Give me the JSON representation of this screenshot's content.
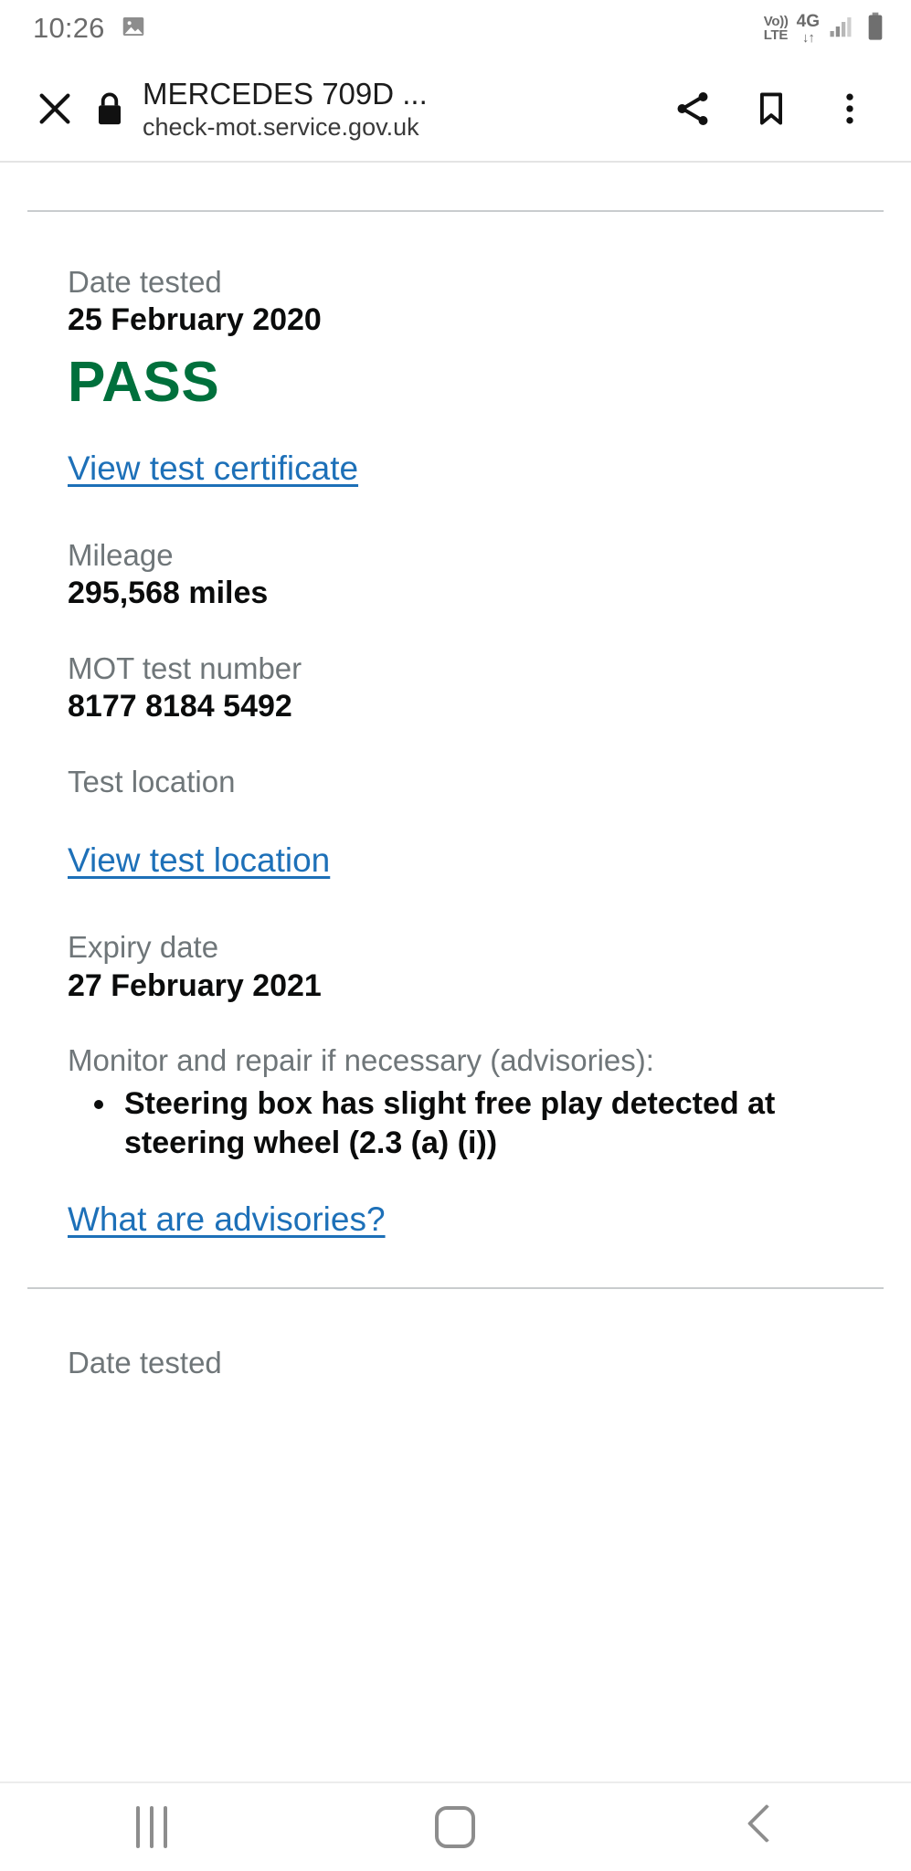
{
  "statusbar": {
    "time": "10:26",
    "image_icon": "image-icon",
    "volte_top": "Vo))",
    "volte_bottom": "LTE",
    "network": "4G",
    "data_arrows": "↓↑",
    "signal_icon": "signal-bars-icon",
    "battery_icon": "battery-icon"
  },
  "browser": {
    "close_icon": "close-icon",
    "lock_icon": "lock-icon",
    "title": "MERCEDES 709D ...",
    "url": "check-mot.service.gov.uk",
    "share_icon": "share-icon",
    "bookmark_icon": "bookmark-icon",
    "overflow_icon": "more-vertical-icon"
  },
  "colors": {
    "pass_green": "#00703c",
    "link_blue": "#1d70b8",
    "label_grey": "#6f7679",
    "value_black": "#0b0c0c",
    "rule_grey": "#c9ccce"
  },
  "mot_record": {
    "date_tested_label": "Date tested",
    "date_tested_value": "25 February 2020",
    "result": "PASS",
    "certificate_link": "View test certificate",
    "mileage_label": "Mileage",
    "mileage_value": "295,568 miles",
    "test_number_label": "MOT test number",
    "test_number_value": "8177 8184 5492",
    "test_location_label": "Test location",
    "test_location_link": "View test location",
    "expiry_label": "Expiry date",
    "expiry_value": "27 February 2021",
    "advisories_label": "Monitor and repair if necessary (advisories):",
    "advisories": [
      "Steering box has slight free play detected at steering wheel (2.3 (a) (i))"
    ],
    "advisories_help_link": "What are advisories?"
  },
  "next_record": {
    "date_tested_label": "Date tested"
  },
  "navbar": {
    "recents_icon": "recents-icon",
    "home_icon": "home-icon",
    "back_icon": "back-icon"
  }
}
